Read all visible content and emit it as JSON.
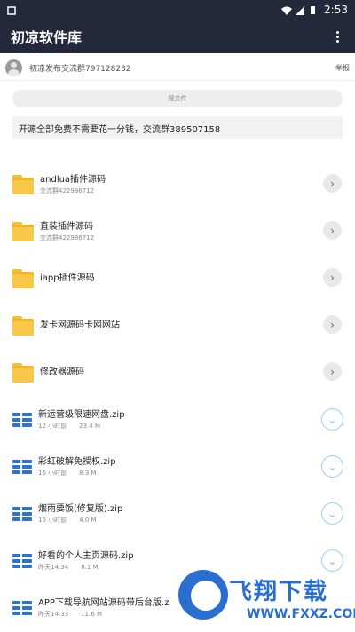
{
  "status_bar": {
    "time": "2:53"
  },
  "app_bar": {
    "title": "初凉软件库"
  },
  "user": {
    "text": "初凉发布交流群797128232",
    "report_label": "举报"
  },
  "search": {
    "placeholder": "搜文件"
  },
  "notice": {
    "text": "开源全部免费不需要花一分钱，交流群389507158"
  },
  "folders": [
    {
      "title": "andlua插件源码",
      "sub": "交流群422986712"
    },
    {
      "title": "直装插件源码",
      "sub": "交流群422986712"
    },
    {
      "title": "iapp插件源码",
      "sub": ""
    },
    {
      "title": "发卡网源码卡网网站",
      "sub": ""
    },
    {
      "title": "修改器源码",
      "sub": ""
    }
  ],
  "files": [
    {
      "title": "新运营级限速网盘.zip",
      "time": "12 小时前",
      "size": "23.4 M"
    },
    {
      "title": "彩虹破解免授权.zip",
      "time": "16 小时前",
      "size": "8.3 M"
    },
    {
      "title": "烟雨要饭(修复版).zip",
      "time": "16 小时前",
      "size": "4.0 M"
    },
    {
      "title": "好看的个人主页源码.zip",
      "time": "昨天14:34",
      "size": "8.1 M"
    },
    {
      "title": "APP下载导航网站源码带后台版.z",
      "time": "昨天14:33",
      "size": "11.6 M"
    }
  ],
  "watermark": {
    "title": "飞翔下载",
    "url": "WWW.FXXZ.COM"
  },
  "colors": {
    "appbar": "#23283a",
    "folder": "#f8c84a",
    "archive": "#2f72d6",
    "download": "#7db9ee"
  }
}
